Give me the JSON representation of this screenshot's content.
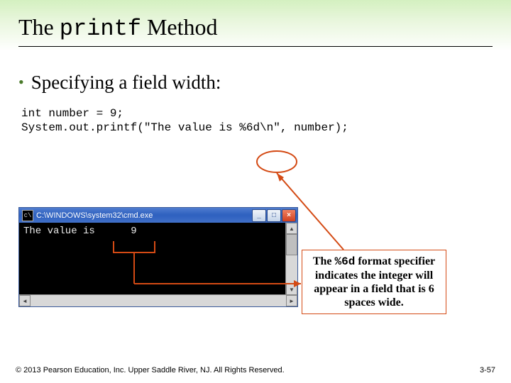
{
  "title": {
    "pre": "The ",
    "code": "printf",
    "post": " Method"
  },
  "bullet": "Specifying a field width:",
  "code": {
    "line1": "int number = 9;",
    "line2": "System.out.printf(\"The value is %6d\\n\", number);"
  },
  "cmd": {
    "icon_glyph": "c\\",
    "title": "C:\\WINDOWS\\system32\\cmd.exe",
    "output_label": "The value is",
    "output_value": "9",
    "min_glyph": "_",
    "max_glyph": "□",
    "close_glyph": "×",
    "arrow_up": "▲",
    "arrow_down": "▼",
    "arrow_left": "◄",
    "arrow_right": "►"
  },
  "callout": {
    "t1": "The ",
    "code": "%6d",
    "t2": " format specifier indicates the integer will appear in a field that is 6 spaces wide."
  },
  "footer": {
    "copyright": "© 2013 Pearson Education, Inc. Upper Saddle River, NJ. All Rights Reserved.",
    "page": "3-57"
  },
  "colors": {
    "accent": "#d44a14"
  }
}
